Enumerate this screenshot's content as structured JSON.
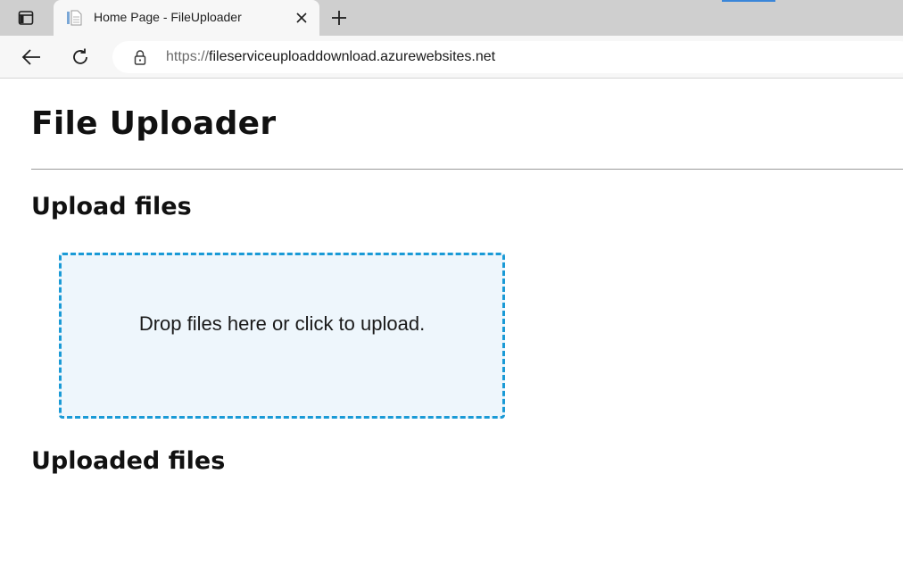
{
  "browser": {
    "tab_title": "Home Page - FileUploader",
    "url_scheme": "https://",
    "url_host": "fileserviceuploaddownload.azurewebsites.net",
    "icons": {
      "tab_actions": "tab-actions-icon",
      "favicon": "page-favicon-icon",
      "close": "close-icon",
      "new_tab": "plus-icon",
      "back": "back-arrow-icon",
      "reload": "reload-icon",
      "lock": "lock-icon"
    },
    "colors": {
      "tabstrip": "#cfcfcf",
      "active_tab": "#f7f7f7"
    }
  },
  "page": {
    "title": "File Uploader",
    "upload_heading": "Upload files",
    "dropzone_message": "Drop files here or click to upload.",
    "uploaded_heading": "Uploaded files",
    "colors": {
      "dropzone_border": "#1a9ad6",
      "dropzone_bg": "#eef6fc"
    }
  }
}
